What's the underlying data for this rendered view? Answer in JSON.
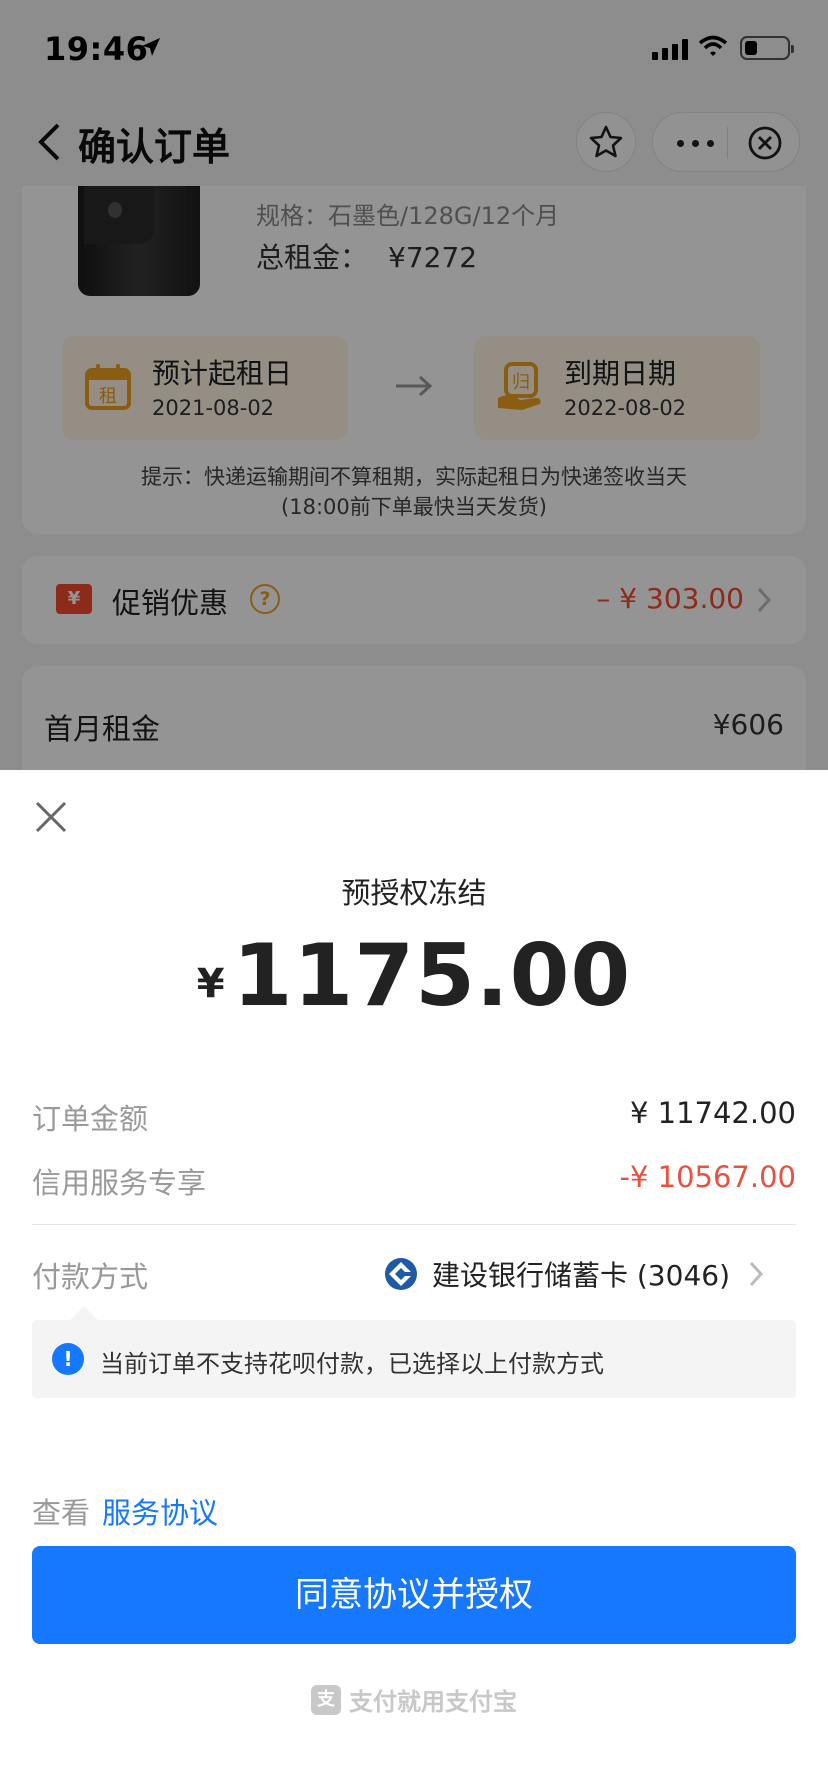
{
  "status_bar": {
    "time": "19:46"
  },
  "navbar": {
    "title": "确认订单"
  },
  "product": {
    "spec": "规格：石墨色/128G/12个月",
    "total_label": "总租金：",
    "total_value": "¥7272"
  },
  "dates": {
    "start_label": "预计起租日",
    "start_value": "2021-08-02",
    "start_icon_text": "租",
    "end_label": "到期日期",
    "end_value": "2022-08-02",
    "end_icon_text": "归"
  },
  "tip": {
    "line1": "提示：快递运输期间不算租期，实际起租日为快递签收当天",
    "line2": "(18:00前下单最快当天发货)"
  },
  "promo": {
    "icon_text": "¥",
    "label": "促销优惠",
    "help": "?",
    "value": "– ¥ 303.00"
  },
  "first_month": {
    "label": "首月租金",
    "value": "¥606"
  },
  "sheet": {
    "title": "预授权冻结",
    "currency": "¥",
    "amount": "1175.00",
    "order_label": "订单金额",
    "order_value": "¥ 11742.00",
    "credit_label": "信用服务专享",
    "credit_value": "-¥ 10567.00",
    "pay_label": "付款方式",
    "pay_value": "建设银行储蓄卡 (3046)",
    "notice": "当前订单不支持花呗付款，已选择以上付款方式",
    "notice_icon": "!",
    "agree_prefix": "查看",
    "agree_link": "服务协议",
    "confirm_button": "同意协议并授权",
    "brand_icon": "支",
    "brand": "支付就用支付宝"
  },
  "colors": {
    "primary": "#1677ff",
    "danger": "#e8523f",
    "warning": "#f0a020"
  },
  "icons": [
    "location-arrow-icon",
    "signal-icon",
    "wifi-icon",
    "battery-icon",
    "back-icon",
    "star-icon",
    "more-icon",
    "mini-close-icon",
    "calendar-icon",
    "return-icon",
    "arrow-right-icon",
    "coupon-icon",
    "help-icon",
    "chevron-right-icon",
    "close-icon",
    "bank-icon",
    "info-icon",
    "alipay-icon"
  ]
}
